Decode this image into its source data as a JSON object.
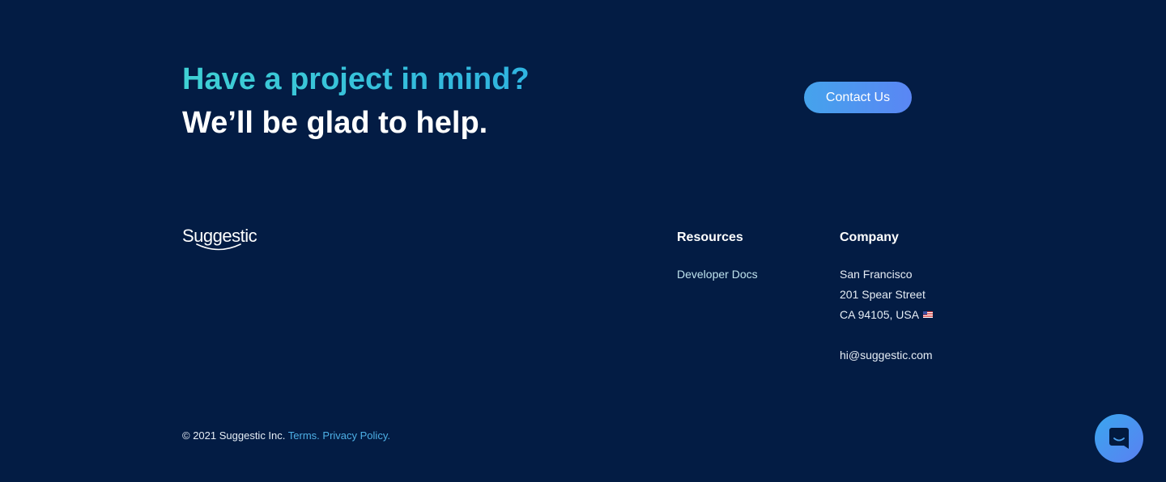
{
  "cta": {
    "line1": "Have a project in mind?",
    "line2": "We’ll be glad to help.",
    "button_label": "Contact Us"
  },
  "brand": {
    "logo_text": "Suggestic"
  },
  "resources": {
    "title": "Resources",
    "links": [
      "Developer Docs"
    ]
  },
  "company": {
    "title": "Company",
    "address": [
      "San Francisco",
      "201 Spear Street",
      "CA 94105, USA"
    ],
    "flag_icon": "us-flag-icon",
    "email": "hi@suggestic.com"
  },
  "footer": {
    "copyright": "© 2021 Suggestic Inc.",
    "terms": "Terms.",
    "privacy": "Privacy Policy."
  },
  "chat": {
    "icon": "chat-icon"
  },
  "colors": {
    "background": "#031c44",
    "accent_teal": "#3ec6d6",
    "button_gradient_start": "#45a3ec",
    "button_gradient_end": "#5a86f4",
    "link": "#4eb0e6"
  }
}
